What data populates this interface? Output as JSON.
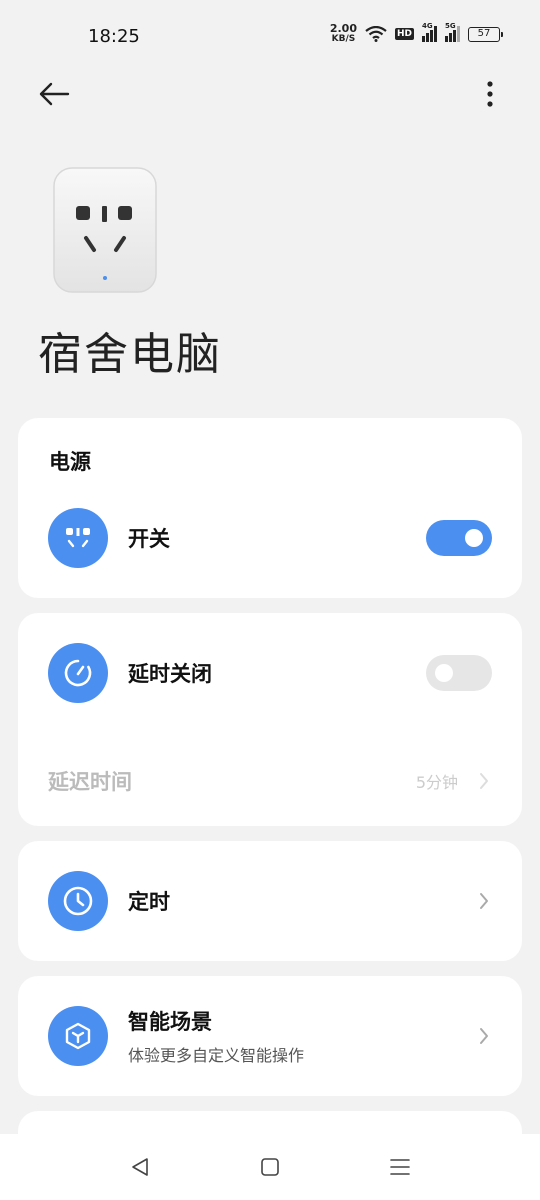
{
  "status_bar": {
    "time": "18:25",
    "net_speed_value": "2.00",
    "net_speed_unit": "KB/S",
    "hd_badge": "HD",
    "sim1_label": "4G",
    "sim2_label": "5G",
    "battery": "57"
  },
  "device": {
    "name": "宿舍电脑"
  },
  "power_card": {
    "title": "电源",
    "switch_label": "开关",
    "switch_on": true
  },
  "delay_card": {
    "label": "延时关闭",
    "toggle_on": false,
    "delay_time_label": "延迟时间",
    "delay_time_value": "5分钟"
  },
  "timer_card": {
    "label": "定时"
  },
  "scene_card": {
    "label": "智能场景",
    "sublabel": "体验更多自定义智能操作"
  },
  "colors": {
    "accent": "#4b8ff0",
    "background": "#f2f2f2",
    "card": "#ffffff",
    "toggle_off": "#e6e6e6"
  },
  "icons": {
    "back": "arrow-left-icon",
    "more": "more-vertical-icon",
    "power": "socket-icon",
    "delay": "timer-dial-icon",
    "timer": "clock-icon",
    "scene": "cube-icon",
    "nav_back": "triangle-back-icon",
    "nav_home": "square-home-icon",
    "nav_menu": "menu-lines-icon"
  }
}
